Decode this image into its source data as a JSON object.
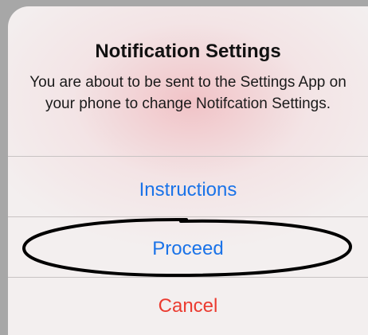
{
  "alert": {
    "title": "Notification Settings",
    "message": "You are about to be sent to the Settings App on your phone to change Notifcation Settings.",
    "actions": [
      {
        "label": "Instructions",
        "style": "default",
        "color": "#1a73e8"
      },
      {
        "label": "Proceed",
        "style": "default",
        "color": "#1a73e8"
      },
      {
        "label": "Cancel",
        "style": "destructive",
        "color": "#eb3b30"
      }
    ]
  },
  "annotation": {
    "shape": "hand-drawn-ellipse",
    "target": "Proceed",
    "color": "#000000"
  }
}
